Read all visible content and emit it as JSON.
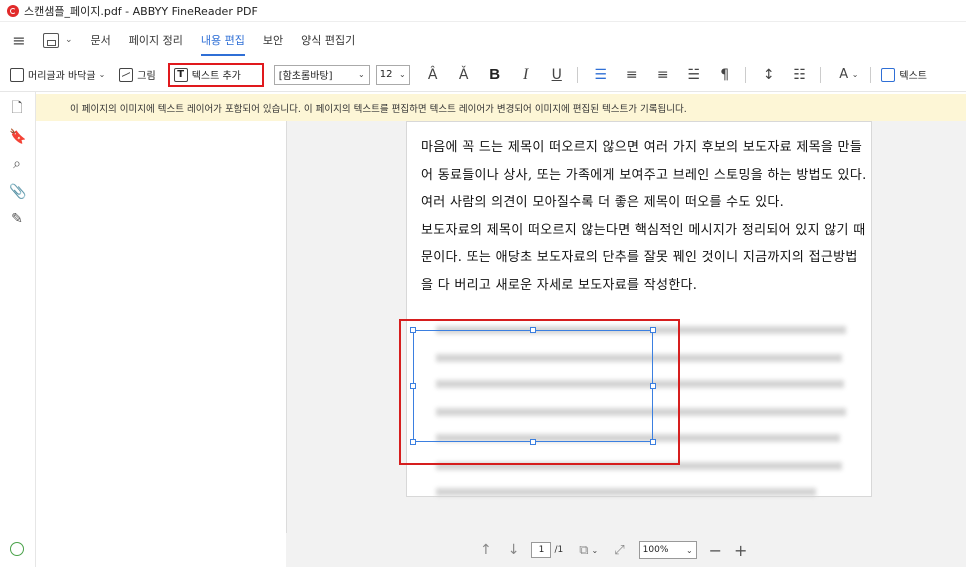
{
  "window": {
    "title": "스캔샘플_페이지.pdf - ABBYY FineReader PDF"
  },
  "menu": {
    "items": [
      {
        "label": "문서"
      },
      {
        "label": "페이지 정리"
      },
      {
        "label": "내용 편집"
      },
      {
        "label": "보안"
      },
      {
        "label": "양식 편집기"
      }
    ]
  },
  "toolbar": {
    "header_footer_label": "머리글과 바닥글",
    "image_label": "그림",
    "add_text_label": "텍스트 추가",
    "font_name": "[함초롬바탕]",
    "font_size": "12",
    "bold": "B",
    "italic": "I",
    "underline": "U",
    "text_label": "텍스트"
  },
  "notice": {
    "message": "이 페이지의 이미지에 텍스트 레이어가 포함되어 있습니다. 이 페이지의 텍스트를 편집하면 텍스트 레이어가 변경되어 이미지에 편집된 텍스트가 기록됩니다."
  },
  "document": {
    "paragraphs": [
      "마음에 꼭 드는 제목이 떠오르지 않으면 여러 가지 후보의 보도자료 제목을 만들어 동료들이나 상사, 또는 가족에게 보여주고 브레인 스토밍을 하는 방법도 있다. 여러 사람의 의견이 모아질수록 더 좋은 제목이 떠오를 수도 있다.",
      "보도자료의 제목이 떠오르지 않는다면 핵심적인 메시지가 정리되어 있지 않기 때문이다. 또는 애당초 보도자료의 단추를 잘못 꿰인 것이니 지금까지의 접근방법을 다 버리고 새로운 자세로 보도자료를 작성한다."
    ]
  },
  "navigation": {
    "current_page": "1",
    "total_pages": "/1",
    "zoom": "100%"
  },
  "colors": {
    "accent": "#2f6fd6",
    "highlight": "#e0191d",
    "notice_bg": "#fdf6d6"
  }
}
